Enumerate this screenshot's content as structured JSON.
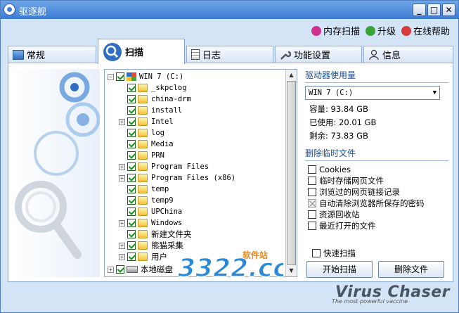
{
  "window": {
    "title": "驱逐舰"
  },
  "toplinks": [
    {
      "label": "内存扫描",
      "color": "#d0308f"
    },
    {
      "label": "升级",
      "color": "#3aa23a"
    },
    {
      "label": "在线帮助",
      "color": "#d63a3a"
    }
  ],
  "tabs": [
    {
      "label": "常规"
    },
    {
      "label": "扫描"
    },
    {
      "label": "日志"
    },
    {
      "label": "功能设置"
    },
    {
      "label": "信息"
    }
  ],
  "tree": {
    "root": "WIN 7 (C:)",
    "items": [
      "_skpclog",
      "china-drm",
      "install",
      "Intel",
      "log",
      "Media",
      "PRN",
      "Program Files",
      "Program Files (x86)",
      "temp",
      "temp9",
      "UPChina",
      "Windows",
      "新建文件夹",
      "熊猫采集",
      "用户"
    ],
    "drives": [
      "本地磁盘"
    ]
  },
  "drive_usage": {
    "section_title": "驱动器使用量",
    "selected_drive": "WIN 7 (C:)",
    "capacity": "容量: 93.84 GB",
    "used": "已使用: 20.01 GB",
    "free": "剩余: 73.83 GB"
  },
  "temp_files": {
    "section_title": "删除临时文件",
    "options": [
      {
        "label": "Cookies",
        "state": "off"
      },
      {
        "label": "临时存储网页文件",
        "state": "off"
      },
      {
        "label": "浏览过的网页链接记录",
        "state": "off"
      },
      {
        "label": "自动清除浏览器所保存的密码",
        "state": "disabled"
      },
      {
        "label": "资源回收站",
        "state": "off"
      },
      {
        "label": "最近打开的文件",
        "state": "off"
      }
    ]
  },
  "quick_scan": {
    "label": "快速扫描"
  },
  "buttons": {
    "start_scan": "开始扫描",
    "delete_files": "删除文件"
  },
  "brand": {
    "name": "Virus Chaser",
    "tagline": "The most powerful vaccine"
  },
  "watermark": {
    "text": "3322.cc",
    "sub": "软件站"
  }
}
